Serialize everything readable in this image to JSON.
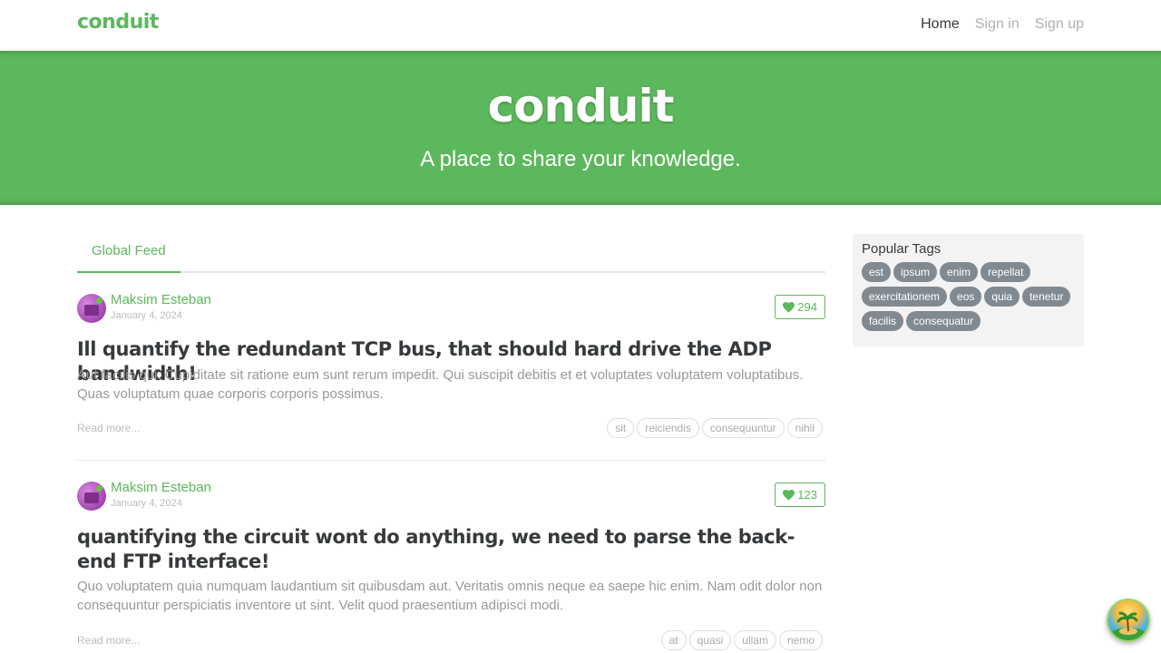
{
  "navbar": {
    "brand": "conduit",
    "links": [
      {
        "label": "Home",
        "active": true
      },
      {
        "label": "Sign in",
        "active": false
      },
      {
        "label": "Sign up",
        "active": false
      }
    ]
  },
  "banner": {
    "title": "conduit",
    "subtitle": "A place to share your knowledge."
  },
  "feed": {
    "tab_label": "Global Feed"
  },
  "articles": [
    {
      "author": "Maksim Esteban",
      "date": "January 4, 2024",
      "favorites": "294",
      "title": "Ill quantify the redundant TCP bus, that should hard drive the ADP bandwidth!",
      "description": "Aut facilis qui. Cupiditate sit ratione eum sunt rerum impedit. Qui suscipit debitis et et voluptates voluptatem voluptatibus. Quas voluptatum quae corporis corporis possimus.",
      "read_more": "Read more...",
      "tags": [
        "sit",
        "reiciendis",
        "consequuntur",
        "nihil"
      ]
    },
    {
      "author": "Maksim Esteban",
      "date": "January 4, 2024",
      "favorites": "123",
      "title": "quantifying the circuit wont do anything, we need to parse the back-end FTP interface!",
      "description": "Quo voluptatem quia numquam laudantium sit quibusdam aut. Veritatis omnis neque ea saepe hic enim. Nam odit dolor non consequuntur perspiciatis inventore ut sint. Velit quod praesentium adipisci modi.",
      "read_more": "Read more...",
      "tags": [
        "at",
        "quasi",
        "ullam",
        "nemo"
      ]
    }
  ],
  "sidebar": {
    "title": "Popular Tags",
    "tags": [
      "est",
      "ipsum",
      "enim",
      "repellat",
      "exercitationem",
      "eos",
      "quia",
      "tenetur",
      "facilis",
      "consequatur"
    ]
  },
  "colors": {
    "brand_green": "#5cb85c",
    "tag_gray": "#818a91"
  },
  "icons": {
    "favorite": "heart-icon",
    "widget": "island-sun-icon"
  }
}
